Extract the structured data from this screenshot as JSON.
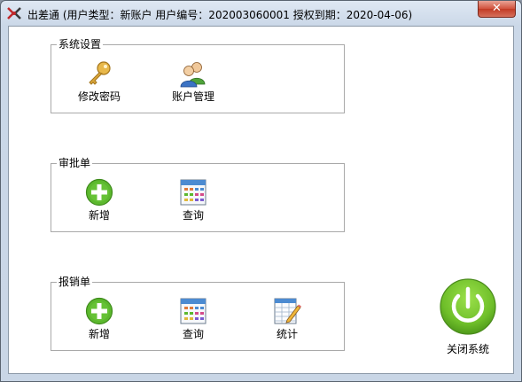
{
  "window": {
    "title": "出差通 (用户类型：新账户  用户编号：202003060001  授权到期：2020-04-06)",
    "close_label": "✕"
  },
  "groups": {
    "system": {
      "legend": "系统设置",
      "buttons": [
        {
          "label": "修改密码",
          "icon": "key-icon"
        },
        {
          "label": "账户管理",
          "icon": "users-icon"
        }
      ]
    },
    "approval": {
      "legend": "审批单",
      "buttons": [
        {
          "label": "新增",
          "icon": "add-icon"
        },
        {
          "label": "查询",
          "icon": "calendar-grid-icon"
        }
      ]
    },
    "reimburse": {
      "legend": "报销单",
      "buttons": [
        {
          "label": "新增",
          "icon": "add-icon"
        },
        {
          "label": "查询",
          "icon": "calendar-grid-icon"
        },
        {
          "label": "统计",
          "icon": "spreadsheet-pencil-icon"
        }
      ]
    }
  },
  "power": {
    "label": "关闭系统",
    "icon": "power-icon"
  },
  "colors": {
    "accent_green": "#5cb82e",
    "power_green": "#6fbf2a",
    "close_red": "#c94a34"
  }
}
